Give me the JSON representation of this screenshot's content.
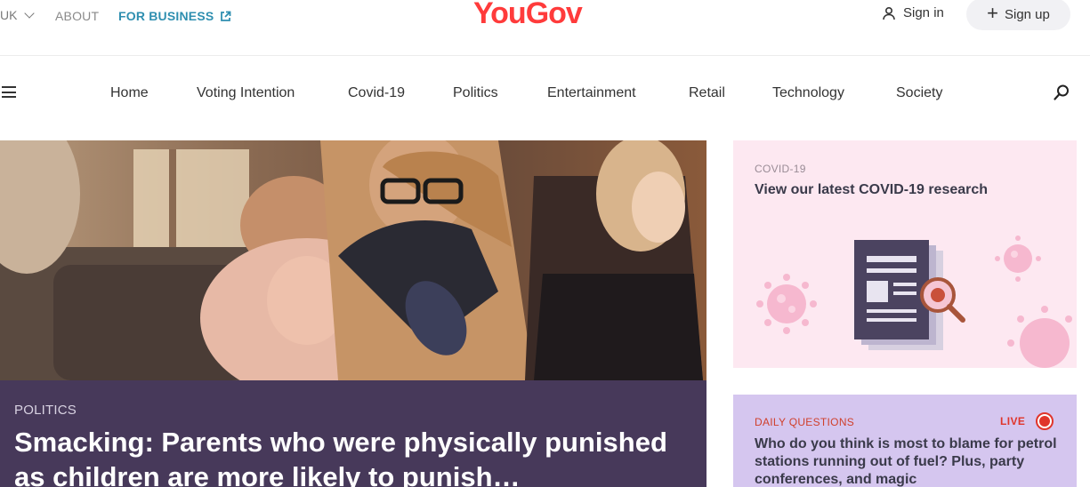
{
  "header": {
    "region": "UK",
    "about": "ABOUT",
    "for_business": "FOR BUSINESS",
    "logo": "YouGov",
    "sign_in": "Sign in",
    "sign_up": "Sign up"
  },
  "nav": {
    "items": [
      "Home",
      "Voting Intention",
      "Covid-19",
      "Politics",
      "Entertainment",
      "Retail",
      "Technology",
      "Society"
    ]
  },
  "hero": {
    "category": "POLITICS",
    "title": "Smacking: Parents who were physically punished as children are more likely to punish…"
  },
  "covid_card": {
    "category": "COVID-19",
    "title": "View our latest COVID-19 research"
  },
  "daily_card": {
    "category": "DAILY QUESTIONS",
    "live": "LIVE",
    "title": "Who do you think is most to blame for petrol stations running out of fuel? Plus, party conferences, and magic"
  },
  "colors": {
    "brand": "#ff3b3b",
    "business": "#2f8fb0",
    "hero_band": "#47395a",
    "covid_card_bg": "#fde8f1",
    "daily_card_bg": "#d5c6ef",
    "live": "#e0352b"
  }
}
